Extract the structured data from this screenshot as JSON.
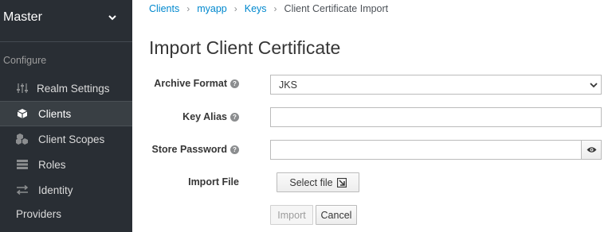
{
  "sidebar": {
    "realm_name": "Master",
    "section_label": "Configure",
    "items": [
      {
        "label": "Realm Settings",
        "icon": "sliders-icon"
      },
      {
        "label": "Clients",
        "icon": "cube-icon"
      },
      {
        "label": "Client Scopes",
        "icon": "cubes-icon"
      },
      {
        "label": "Roles",
        "icon": "list-icon"
      },
      {
        "label": "Identity",
        "icon": "exchange-icon"
      },
      {
        "label": "Providers"
      }
    ],
    "active_item": "Clients"
  },
  "breadcrumb": [
    "Clients",
    "myapp",
    "Keys",
    "Client Certificate Import"
  ],
  "page_title": "Import Client Certificate",
  "form": {
    "archive_format": {
      "label": "Archive Format",
      "value": "JKS"
    },
    "key_alias": {
      "label": "Key Alias",
      "value": ""
    },
    "store_password": {
      "label": "Store Password",
      "value": ""
    },
    "import_file": {
      "label": "Import File",
      "button": "Select file"
    }
  },
  "buttons": {
    "import": "Import",
    "cancel": "Cancel"
  },
  "colors": {
    "sidebar_bg": "#292e34",
    "link": "#0088ce"
  }
}
